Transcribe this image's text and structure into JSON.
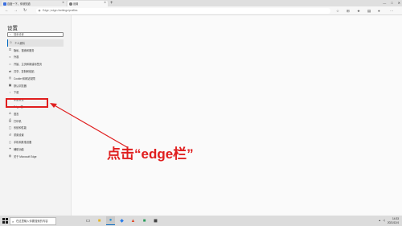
{
  "browser": {
    "tabs": [
      {
        "label": "百度一下，你就知道",
        "active": false,
        "icon": "baidu-icon"
      },
      {
        "label": "设置",
        "active": true,
        "icon": "settings-icon"
      }
    ],
    "new_tab": "+",
    "window_controls": [
      "—",
      "□",
      "✕"
    ],
    "address": {
      "prefix": "Edge",
      "separator": "|",
      "url": "edge://settings/profiles"
    }
  },
  "settings": {
    "title": "设置",
    "search_placeholder": "搜索设置",
    "nav_items": [
      {
        "label": "个人资料",
        "icon": "profile-icon",
        "active": true
      },
      {
        "label": "隐私、搜索和服务",
        "icon": "lock-icon"
      },
      {
        "label": "外观",
        "icon": "appearance-icon"
      },
      {
        "label": "开始、主页和新建标签页",
        "icon": "home-icon"
      },
      {
        "label": "共享、复制和粘贴",
        "icon": "share-icon"
      },
      {
        "label": "Cookie 和网站权限",
        "icon": "cookie-icon"
      },
      {
        "label": "默认浏览器",
        "icon": "browser-icon"
      },
      {
        "label": "下载",
        "icon": "download-icon"
      },
      {
        "label": "家庭安全",
        "icon": "family-icon"
      },
      {
        "label": "Edge 栏",
        "icon": "edge-bar-icon"
      },
      {
        "label": "语言",
        "icon": "language-icon"
      },
      {
        "label": "打印机",
        "icon": "printer-icon"
      },
      {
        "label": "系统和性能",
        "icon": "system-icon"
      },
      {
        "label": "重置设置",
        "icon": "reset-icon"
      },
      {
        "label": "手机和其他设备",
        "icon": "phone-icon"
      },
      {
        "label": "辅助功能",
        "icon": "accessibility-icon"
      },
      {
        "label": "关于 Microsoft Edge",
        "icon": "edge-logo-icon"
      }
    ]
  },
  "annotation": {
    "callout": "点击“edge栏”",
    "color": "#e01e1e"
  },
  "taskbar": {
    "search_placeholder": "在这里输入你要搜索的内容",
    "time": "14:33",
    "date": "2021/12/4"
  },
  "colors": {
    "accent": "#0067c0",
    "annotation": "#e01e1e"
  }
}
